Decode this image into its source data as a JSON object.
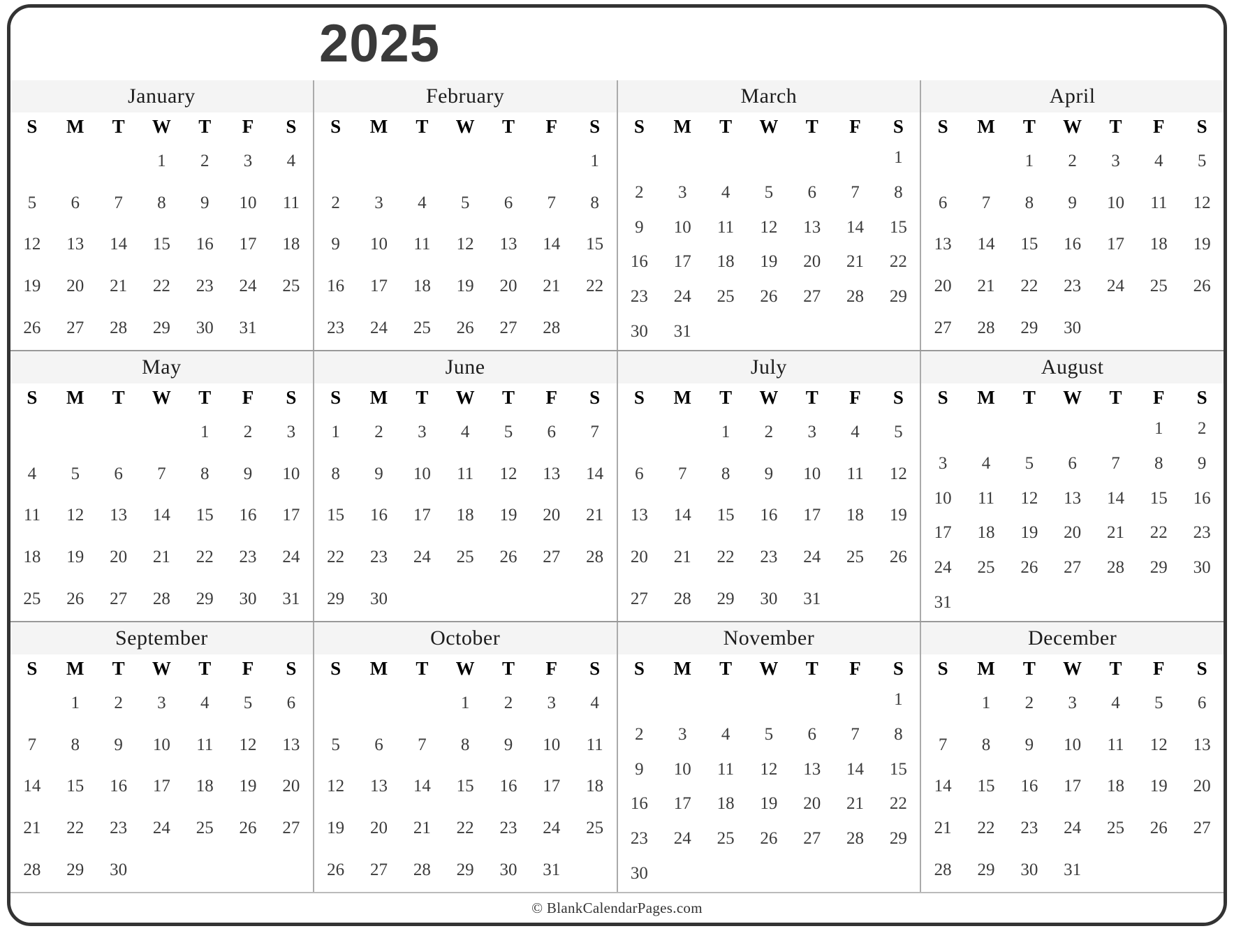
{
  "header": {
    "year_title": "2025"
  },
  "footer": {
    "copyright": "© BlankCalendarPages.com"
  },
  "weekday_headers": [
    "S",
    "M",
    "T",
    "W",
    "T",
    "F",
    "S"
  ],
  "colors": {
    "frame_border": "#333333",
    "month_header_bg": "#f4f4f4",
    "divider": "#999999",
    "day_text": "#3b3b3b",
    "title_text": "#3a3a3a"
  },
  "calendar": {
    "year": "2025",
    "quarters": [
      {
        "months": [
          {
            "name": "January",
            "weeks": [
              [
                "",
                "",
                "",
                "1",
                "2",
                "3",
                "4"
              ],
              [
                "5",
                "6",
                "7",
                "8",
                "9",
                "10",
                "11"
              ],
              [
                "12",
                "13",
                "14",
                "15",
                "16",
                "17",
                "18"
              ],
              [
                "19",
                "20",
                "21",
                "22",
                "23",
                "24",
                "25"
              ],
              [
                "26",
                "27",
                "28",
                "29",
                "30",
                "31",
                ""
              ]
            ]
          },
          {
            "name": "February",
            "weeks": [
              [
                "",
                "",
                "",
                "",
                "",
                "",
                "1"
              ],
              [
                "2",
                "3",
                "4",
                "5",
                "6",
                "7",
                "8"
              ],
              [
                "9",
                "10",
                "11",
                "12",
                "13",
                "14",
                "15"
              ],
              [
                "16",
                "17",
                "18",
                "19",
                "20",
                "21",
                "22"
              ],
              [
                "23",
                "24",
                "25",
                "26",
                "27",
                "28",
                ""
              ]
            ]
          },
          {
            "name": "March",
            "weeks": [
              [
                "",
                "",
                "",
                "",
                "",
                "",
                "1"
              ],
              [
                "2",
                "3",
                "4",
                "5",
                "6",
                "7",
                "8"
              ],
              [
                "9",
                "10",
                "11",
                "12",
                "13",
                "14",
                "15"
              ],
              [
                "16",
                "17",
                "18",
                "19",
                "20",
                "21",
                "22"
              ],
              [
                "23",
                "24",
                "25",
                "26",
                "27",
                "28",
                "29"
              ],
              [
                "30",
                "31",
                "",
                "",
                "",
                "",
                ""
              ]
            ]
          },
          {
            "name": "April",
            "weeks": [
              [
                "",
                "",
                "1",
                "2",
                "3",
                "4",
                "5"
              ],
              [
                "6",
                "7",
                "8",
                "9",
                "10",
                "11",
                "12"
              ],
              [
                "13",
                "14",
                "15",
                "16",
                "17",
                "18",
                "19"
              ],
              [
                "20",
                "21",
                "22",
                "23",
                "24",
                "25",
                "26"
              ],
              [
                "27",
                "28",
                "29",
                "30",
                "",
                "",
                ""
              ]
            ]
          }
        ]
      },
      {
        "months": [
          {
            "name": "May",
            "weeks": [
              [
                "",
                "",
                "",
                "",
                "1",
                "2",
                "3"
              ],
              [
                "4",
                "5",
                "6",
                "7",
                "8",
                "9",
                "10"
              ],
              [
                "11",
                "12",
                "13",
                "14",
                "15",
                "16",
                "17"
              ],
              [
                "18",
                "19",
                "20",
                "21",
                "22",
                "23",
                "24"
              ],
              [
                "25",
                "26",
                "27",
                "28",
                "29",
                "30",
                "31"
              ]
            ]
          },
          {
            "name": "June",
            "weeks": [
              [
                "1",
                "2",
                "3",
                "4",
                "5",
                "6",
                "7"
              ],
              [
                "8",
                "9",
                "10",
                "11",
                "12",
                "13",
                "14"
              ],
              [
                "15",
                "16",
                "17",
                "18",
                "19",
                "20",
                "21"
              ],
              [
                "22",
                "23",
                "24",
                "25",
                "26",
                "27",
                "28"
              ],
              [
                "29",
                "30",
                "",
                "",
                "",
                "",
                ""
              ]
            ]
          },
          {
            "name": "July",
            "weeks": [
              [
                "",
                "",
                "1",
                "2",
                "3",
                "4",
                "5"
              ],
              [
                "6",
                "7",
                "8",
                "9",
                "10",
                "11",
                "12"
              ],
              [
                "13",
                "14",
                "15",
                "16",
                "17",
                "18",
                "19"
              ],
              [
                "20",
                "21",
                "22",
                "23",
                "24",
                "25",
                "26"
              ],
              [
                "27",
                "28",
                "29",
                "30",
                "31",
                "",
                ""
              ]
            ]
          },
          {
            "name": "August",
            "weeks": [
              [
                "",
                "",
                "",
                "",
                "",
                "1",
                "2"
              ],
              [
                "3",
                "4",
                "5",
                "6",
                "7",
                "8",
                "9"
              ],
              [
                "10",
                "11",
                "12",
                "13",
                "14",
                "15",
                "16"
              ],
              [
                "17",
                "18",
                "19",
                "20",
                "21",
                "22",
                "23"
              ],
              [
                "24",
                "25",
                "26",
                "27",
                "28",
                "29",
                "30"
              ],
              [
                "31",
                "",
                "",
                "",
                "",
                "",
                ""
              ]
            ]
          }
        ]
      },
      {
        "months": [
          {
            "name": "September",
            "weeks": [
              [
                "",
                "1",
                "2",
                "3",
                "4",
                "5",
                "6"
              ],
              [
                "7",
                "8",
                "9",
                "10",
                "11",
                "12",
                "13"
              ],
              [
                "14",
                "15",
                "16",
                "17",
                "18",
                "19",
                "20"
              ],
              [
                "21",
                "22",
                "23",
                "24",
                "25",
                "26",
                "27"
              ],
              [
                "28",
                "29",
                "30",
                "",
                "",
                "",
                ""
              ]
            ]
          },
          {
            "name": "October",
            "weeks": [
              [
                "",
                "",
                "",
                "1",
                "2",
                "3",
                "4"
              ],
              [
                "5",
                "6",
                "7",
                "8",
                "9",
                "10",
                "11"
              ],
              [
                "12",
                "13",
                "14",
                "15",
                "16",
                "17",
                "18"
              ],
              [
                "19",
                "20",
                "21",
                "22",
                "23",
                "24",
                "25"
              ],
              [
                "26",
                "27",
                "28",
                "29",
                "30",
                "31",
                ""
              ]
            ]
          },
          {
            "name": "November",
            "weeks": [
              [
                "",
                "",
                "",
                "",
                "",
                "",
                "1"
              ],
              [
                "2",
                "3",
                "4",
                "5",
                "6",
                "7",
                "8"
              ],
              [
                "9",
                "10",
                "11",
                "12",
                "13",
                "14",
                "15"
              ],
              [
                "16",
                "17",
                "18",
                "19",
                "20",
                "21",
                "22"
              ],
              [
                "23",
                "24",
                "25",
                "26",
                "27",
                "28",
                "29"
              ],
              [
                "30",
                "",
                "",
                "",
                "",
                "",
                ""
              ]
            ]
          },
          {
            "name": "December",
            "weeks": [
              [
                "",
                "1",
                "2",
                "3",
                "4",
                "5",
                "6"
              ],
              [
                "7",
                "8",
                "9",
                "10",
                "11",
                "12",
                "13"
              ],
              [
                "14",
                "15",
                "16",
                "17",
                "18",
                "19",
                "20"
              ],
              [
                "21",
                "22",
                "23",
                "24",
                "25",
                "26",
                "27"
              ],
              [
                "28",
                "29",
                "30",
                "31",
                "",
                "",
                ""
              ]
            ]
          }
        ]
      }
    ]
  }
}
